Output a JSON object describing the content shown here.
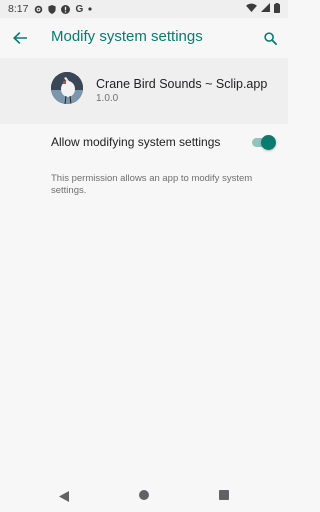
{
  "status_bar": {
    "time": "8:17",
    "icons": [
      "gear-icon",
      "shield-icon",
      "alert-icon",
      "google-icon",
      "dot-icon"
    ],
    "google_letter": "G",
    "right_icons": [
      "wifi-icon",
      "signal-icon",
      "battery-icon"
    ]
  },
  "app_bar": {
    "title": "Modify system settings",
    "back_icon": "arrow-left-icon",
    "search_icon": "search-icon"
  },
  "app_info": {
    "name": "Crane Bird Sounds ~ Sclip.app",
    "version": "1.0.0"
  },
  "setting": {
    "label": "Allow modifying system settings",
    "enabled": true
  },
  "description": "This permission allows an app to modify system settings.",
  "nav_bar": {
    "icons": [
      "nav-back-icon",
      "nav-home-icon",
      "nav-recents-icon"
    ]
  },
  "colors": {
    "accent": "#0b7a6f",
    "toggle_track": "#8ec6bf",
    "background": "#f7f7f7",
    "header_background": "#efefef"
  }
}
